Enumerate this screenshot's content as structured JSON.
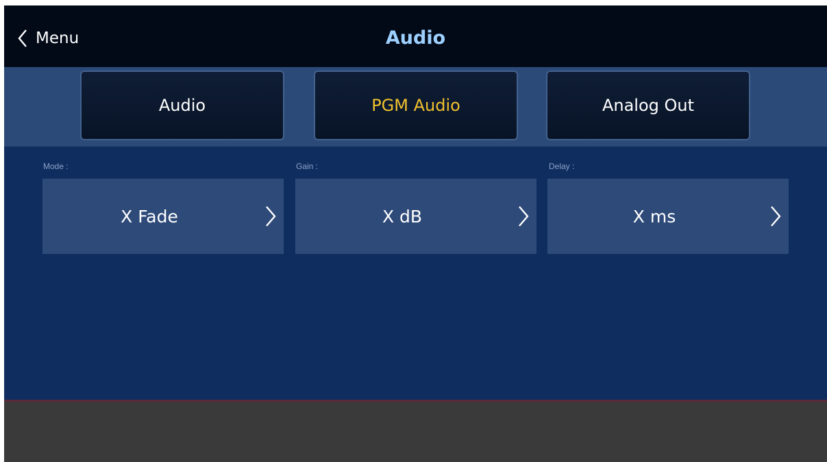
{
  "header": {
    "back_label": "Menu",
    "title": "Audio"
  },
  "tabs": [
    {
      "label": "Audio",
      "active": false
    },
    {
      "label": "PGM Audio",
      "active": true
    },
    {
      "label": "Analog Out",
      "active": false
    }
  ],
  "fields": {
    "mode": {
      "label": "Mode :",
      "value": "X Fade"
    },
    "gain": {
      "label": "Gain :",
      "value": "X dB"
    },
    "delay": {
      "label": "Delay :",
      "value": "X ms"
    }
  },
  "icons": {
    "back": "chevron-left-icon",
    "field_arrow": "chevron-right-icon"
  },
  "colors": {
    "title": "#9ed0ff",
    "active_tab": "#f2c12e",
    "background": "#102d60",
    "topbar": "#020a18"
  }
}
